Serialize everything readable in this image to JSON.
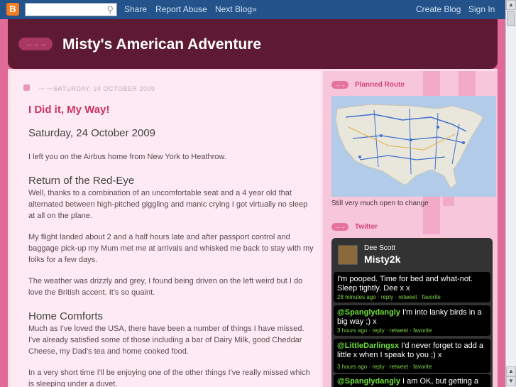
{
  "navbar": {
    "logo": "B",
    "search_placeholder": "",
    "share": "Share",
    "report_abuse": "Report Abuse",
    "next_blog": "Next Blog»",
    "create_blog": "Create Blog",
    "sign_in": "Sign In"
  },
  "header": {
    "title": "Misty's American Adventure"
  },
  "post": {
    "date_header": "SATURDAY, 24 OCTOBER 2009",
    "title": "I Did it, My Way!",
    "date": "Saturday, 24 October 2009",
    "intro": "I left you on the Airbus home from New York to Heathrow.",
    "h1": "Return of the Red-Eye",
    "p1": "Well, thanks to a combination of an uncomfortable seat and a 4 year old that alternated between high-pitched giggling and manic crying I got virtually no sleep at all on the plane.",
    "p2": "My flight landed about 2 and a half hours late and after passport control and baggage pick-up my Mum met me at arrivals and whisked me back to stay with my folks for a few days.",
    "p3": "The weather was drizzly and grey, I found being driven on the left weird but I do love the British accent. It's so quaint.",
    "h2": "Home Comforts",
    "p4": "Much as I've loved the USA, there have been a number of things I have missed. I've already satisfied some of those including a bar of Dairy Milk, good Cheddar Cheese, my Dad's tea and home cooked food.",
    "p5": "In a very short time I'll be enjoying one of the other things I've really missed which is sleeping under a duvet."
  },
  "sidebar": {
    "route_title": "Planned Route",
    "map_caption": "Still very much open to change",
    "twitter_title": "Twitter",
    "twitter": {
      "name": "Dee Scott",
      "handle": "Misty2k",
      "tweets": [
        {
          "mention": "",
          "text": "I'm pooped. Time for bed and what-not. Sleep tightly. Dee x x",
          "meta": "28 minutes ago · reply · retweet · favorite"
        },
        {
          "mention": "@Spanglydangly",
          "text": " I'm into lanky birds in a big way ;) x",
          "meta": "3 hours ago · reply · retweet · favorite"
        },
        {
          "mention": "@LittleDarlingsx",
          "text": " I'd never forget to add a little x when I speak to you ;) x",
          "meta": "3 hours ago · reply · retweet · favorite"
        },
        {
          "mention": "@Spanglydangly",
          "text": " I am OK, but getting a bit",
          "meta": ""
        }
      ]
    }
  },
  "colors": {
    "navbar": "#23538a",
    "header": "#5e1a33",
    "accent": "#cc3366",
    "background": "#e06a98",
    "twitter_mention": "#6ee038"
  }
}
